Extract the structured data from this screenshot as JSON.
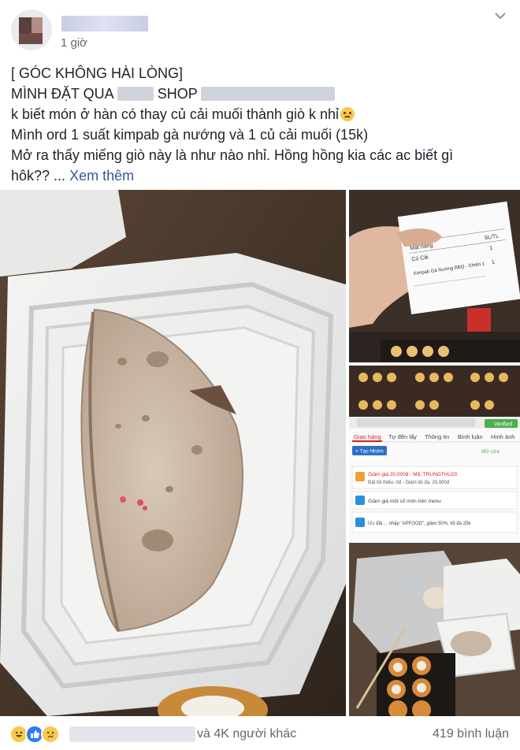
{
  "post": {
    "timestamp": "1 giờ",
    "lines": {
      "l1": "[ GÓC KHÔNG HÀI LÒNG]",
      "l2a": "MÌNH ĐẶT QUA",
      "l2b": "SHOP",
      "l3": "k biết món ở hàn có thay củ cải muối thành giò k nhỉ",
      "l4": "Mình ord 1 suất kimpab gà nướng và 1 củ cải muối (15k)",
      "l5": "Mở ra thấy miếng giò này là như nào nhỉ. Hồng hồng kia các ac biết gì",
      "l6": "hôk?? ..."
    },
    "see_more": "Xem thêm",
    "emoji_icon": "confused-face-emoji"
  },
  "receipt": {
    "col1": "Mặt hàng",
    "col2": "SL/TL",
    "item1": "Củ Cải",
    "qty1": "1",
    "item2": "Kimpab Gà Nướng BBQ - Chiên 1",
    "qty2": "1"
  },
  "app": {
    "verified": "Verified",
    "tabs": [
      "Giao hàng",
      "Tự đến lấy",
      "Thông tin",
      "Bình luận",
      "Hình ảnh"
    ],
    "create_group": "+ Tạo Nhóm",
    "open_status": "Mở cửa",
    "promo1_line1": "Giảm giá 20,000đ - Mã: TRUNGTHU20",
    "promo1_line2": "Đặt tối thiểu: 0đ - Giảm tối đa: 20,000đ",
    "promo2": "Giảm giá một số món trên menu",
    "promo3": "Ưu đãi ... nhập \"APFOOD\", giảm 50%, tối đa 25k"
  },
  "footer": {
    "reaction_icons": [
      "haha-reaction-icon",
      "like-reaction-icon",
      "sad-reaction-icon"
    ],
    "others_text": "và 4K người khác",
    "comments_text": "419 bình luận"
  },
  "colors": {
    "link": "#365899",
    "text": "#1d2129",
    "muted": "#616770",
    "like_blue": "#2f7bf5",
    "promo_red": "#e02020"
  }
}
